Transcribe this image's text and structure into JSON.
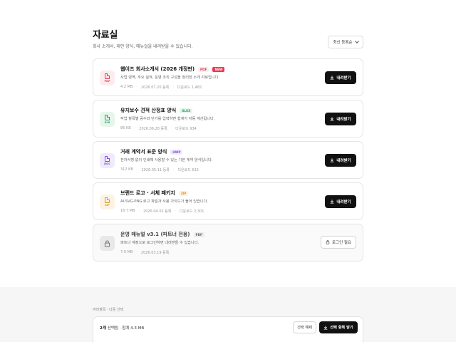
{
  "header": {
    "title": "자료실",
    "subtitle": "회사 소개서, 제안 양식, 매뉴얼을 내려받을 수 있습니다.",
    "sort_label": "최신 등록순"
  },
  "files": [
    {
      "title": "웹이즈 회사소개서 (2026 개정판)",
      "ext_tag": "PDF",
      "new_tag": "NEW",
      "icon_ext": "PDF",
      "icon": "pdf-file-icon",
      "color": "#e8384f",
      "bg": "#fdecee",
      "description": "사업 영역, 주요 실적, 운영 조직 구성을 정리한 소개 자료입니다.",
      "size": "4.2 MB",
      "date": "2026.07.20 등록",
      "downloads": "다운로드 1,482",
      "action": "내려받기",
      "locked": false
    },
    {
      "title": "유지보수 견적 산정표 양식",
      "ext_tag": "XLSX",
      "icon_ext": "XLS",
      "icon": "xls-file-icon",
      "color": "#1f9d55",
      "bg": "#e6f6ec",
      "description": "작업 항목별 공수와 단가를 입력하면 합계가 자동 계산됩니다.",
      "size": "86 KB",
      "date": "2026.06.28 등록",
      "downloads": "다운로드 934",
      "action": "내려받기",
      "locked": false
    },
    {
      "title": "거래 계약서 표준 양식",
      "ext_tag": "HWP",
      "icon_ext": "DOC",
      "icon": "doc-file-icon",
      "color": "#7c4ddb",
      "bg": "#f0eafd",
      "description": "전자서명 없이 인쇄해 사용할 수 있는 기본 계약 양식입니다.",
      "size": "312 KB",
      "date": "2026.05.11 등록",
      "downloads": "다운로드 615",
      "action": "내려받기",
      "locked": false
    },
    {
      "title": "브랜드 로고 · 서체 패키지",
      "ext_tag": "ZIP",
      "icon_ext": "ZIP",
      "icon": "zip-file-icon",
      "color": "#e0951f",
      "bg": "#fdf3e3",
      "description": "AI·SVG·PNG 로고 파일과 사용 가이드가 들어 있습니다.",
      "size": "18.7 MB",
      "date": "2026.04.02 등록",
      "downloads": "다운로드 2,301",
      "action": "내려받기",
      "locked": false
    },
    {
      "title": "운영 매뉴얼 v3.1 (파트너 전용)",
      "ext_tag": "PDF",
      "icon": "lock-icon",
      "color": "#666666",
      "bg": "#e8e8e8",
      "description": "파트너 계정으로 로그인하면 내려받을 수 있습니다.",
      "size": "7.9 MB",
      "date": "2026.03.19 등록",
      "downloads": "",
      "action": "로그인 필요",
      "locked": true
    }
  ],
  "selection": {
    "section_label": "여러항목 · 다중 선택",
    "count": "2개",
    "count_suffix": "선택됨 · 합계 4.3 MB",
    "clear_label": "선택 해제",
    "download_label": "선택 항목 받기"
  }
}
